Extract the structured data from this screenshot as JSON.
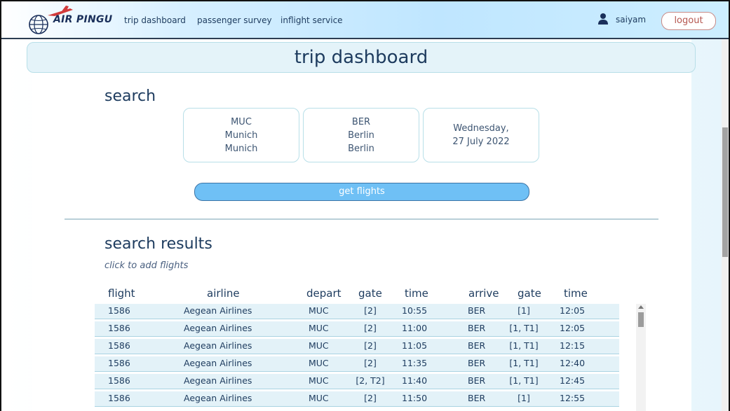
{
  "app": {
    "logo_text": "AIR PINGU"
  },
  "nav": {
    "items": [
      "trip dashboard",
      "passenger survey",
      "inflight service"
    ]
  },
  "user": {
    "name": "saiyam",
    "logout_label": "logout"
  },
  "page": {
    "title": "trip dashboard"
  },
  "search": {
    "title": "search",
    "origin": {
      "code": "MUC",
      "city": "Munich",
      "airport": "Munich"
    },
    "destination": {
      "code": "BER",
      "city": "Berlin",
      "airport": "Berlin"
    },
    "date": {
      "line1": "Wednesday,",
      "line2": "27 July 2022"
    },
    "button_label": "get flights"
  },
  "results": {
    "title": "search results",
    "hint": "click to add flights",
    "columns": [
      "flight",
      "airline",
      "depart",
      "gate",
      "time",
      "arrive",
      "gate",
      "time"
    ],
    "rows": [
      [
        "1586",
        "Aegean Airlines",
        "MUC",
        "[2]",
        "10:55",
        "BER",
        "[1]",
        "12:05"
      ],
      [
        "1586",
        "Aegean Airlines",
        "MUC",
        "[2]",
        "11:00",
        "BER",
        "[1, T1]",
        "12:05"
      ],
      [
        "1586",
        "Aegean Airlines",
        "MUC",
        "[2]",
        "11:05",
        "BER",
        "[1, T1]",
        "12:15"
      ],
      [
        "1586",
        "Aegean Airlines",
        "MUC",
        "[2]",
        "11:35",
        "BER",
        "[1, T1]",
        "12:40"
      ],
      [
        "1586",
        "Aegean Airlines",
        "MUC",
        "[2, T2]",
        "11:40",
        "BER",
        "[1, T1]",
        "12:45"
      ],
      [
        "1586",
        "Aegean Airlines",
        "MUC",
        "[2]",
        "11:50",
        "BER",
        "[1]",
        "12:55"
      ]
    ]
  },
  "colors": {
    "accent": "#6fc0f5",
    "title_bar": "#e4f3f9",
    "row_bg": "#e3f2f8",
    "logout": "#b5564f"
  },
  "icons": {
    "logo": "globe-plane-icon",
    "user": "user-icon"
  }
}
